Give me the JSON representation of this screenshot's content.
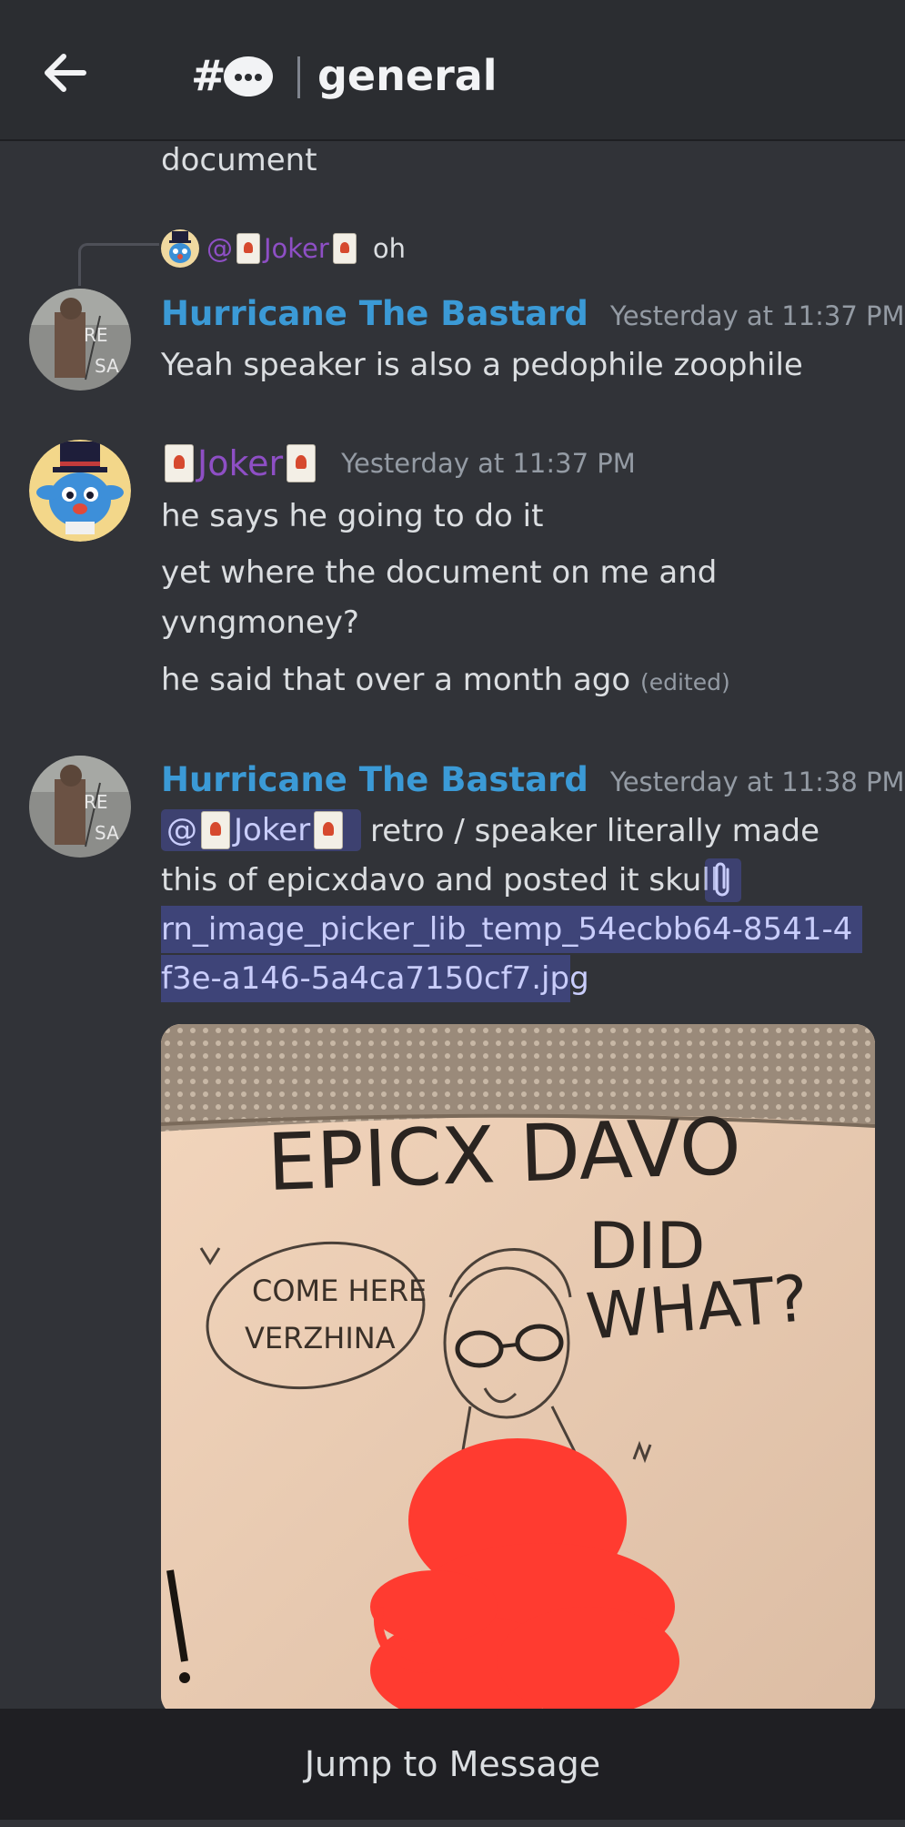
{
  "header": {
    "channel_prefix": "#",
    "channel_name": "general"
  },
  "messages": {
    "continued_text": "document",
    "reply": {
      "at": "@",
      "mention_name": "Joker",
      "text": "oh"
    },
    "msg1": {
      "author": "Hurricane The Bastard",
      "timestamp": "Yesterday at 11:37 PM",
      "text": "Yeah speaker is also a pedophile zoophile",
      "avatar_text_1": "RE",
      "avatar_text_2": "SA"
    },
    "msg2": {
      "author": "Joker",
      "timestamp": "Yesterday at 11:37 PM",
      "line1": "he says he going to do it",
      "line2a": "yet where the document on me and",
      "line2b": "yvngmoney?",
      "line3": "he said that over a month ago",
      "edited": "(edited)"
    },
    "msg3": {
      "author": "Hurricane The Bastard",
      "timestamp": "Yesterday at 11:38 PM",
      "mention_at": "@",
      "mention_name": "Joker",
      "line1_rest": "retro / speaker literally made",
      "line2": "this of epicxdavo and posted it skull",
      "attachment_line1": "rn_image_picker_lib_temp_54ecbb64-8541-4",
      "attachment_line2": "f3e-a146-5a4ca7150cf7.jpg",
      "avatar_text_1": "RE",
      "avatar_text_2": "SA"
    },
    "image_text": {
      "title": "EPICX DAVO",
      "did": "DID",
      "what": "WHAT?",
      "bubble1": "COME HERE",
      "bubble2": "VERZHINA"
    }
  },
  "footer": {
    "jump_label": "Jump to Message"
  },
  "colors": {
    "background": "#313338",
    "header": "#2b2d31",
    "username_blue": "#3b9ad6",
    "joker_purple": "#8e4fc5",
    "mention_bg": "#5865f2",
    "redaction": "#ff3b30"
  }
}
